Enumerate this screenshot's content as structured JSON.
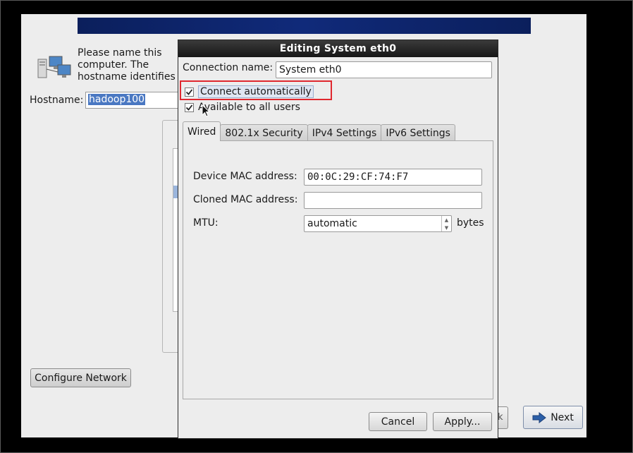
{
  "installer": {
    "intro_text": "Please name this computer.  The\nhostname identifies the computer on a\nnetwork.",
    "hostname_label": "Hostname:",
    "hostname_value": "hadoop100",
    "configure_network_label": "Configure Network",
    "back_stub_label": "k",
    "next_label": "Next"
  },
  "dialog": {
    "title": "Editing System eth0",
    "connection_name_label": "Connection name:",
    "connection_name_value": "System eth0",
    "connect_automatically_label": "Connect automatically",
    "connect_automatically_checked": true,
    "available_to_all_users_label": "Available to all users",
    "available_to_all_users_checked": true,
    "tabs": [
      {
        "label": "Wired",
        "active": true
      },
      {
        "label": "802.1x Security",
        "active": false
      },
      {
        "label": "IPv4 Settings",
        "active": false
      },
      {
        "label": "IPv6 Settings",
        "active": false
      }
    ],
    "wired": {
      "device_mac_label": "Device MAC address:",
      "device_mac_value": "00:0C:29:CF:74:F7",
      "cloned_mac_label": "Cloned MAC address:",
      "cloned_mac_value": "",
      "mtu_label": "MTU:",
      "mtu_value": "automatic",
      "mtu_unit": "bytes"
    },
    "cancel_label": "Cancel",
    "apply_label": "Apply..."
  },
  "colors": {
    "highlight_box": "#e0282f",
    "banner": "#102a7a",
    "selection": "#4a78c2"
  }
}
